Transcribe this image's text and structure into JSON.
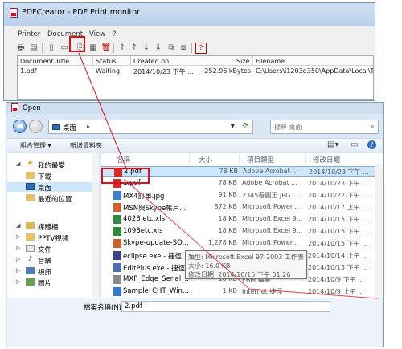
{
  "monitor": {
    "title": "PDFCreator - PDF Print monitor",
    "menu": [
      "Printer",
      "Document",
      "View",
      "?"
    ],
    "columns": [
      "Document Title",
      "Status",
      "Created on",
      "Size",
      "Filename"
    ],
    "row": {
      "title": "1.pdf",
      "status": "Waiting",
      "created": "2014/10/23 下午 ...",
      "size": "252.96 kBytes",
      "filename": "C:\\Users\\i1203q350\\AppData\\Local\\Temp\\M"
    }
  },
  "dialog": {
    "title": "Open",
    "address": "桌面",
    "search_placeholder": "搜尋 桌面",
    "organize": "組合管理 ▾",
    "new_folder": "新增資料夾",
    "nav": [
      {
        "label": "我的最愛",
        "icon": "star-icon"
      },
      {
        "label": "下載",
        "icon": "download-folder-icon"
      },
      {
        "label": "桌面",
        "icon": "desktop-icon"
      },
      {
        "label": "最近的位置",
        "icon": "recent-places-icon"
      },
      {
        "label": "媒體櫃",
        "icon": "library-icon"
      },
      {
        "label": "PPTV視頻",
        "icon": "folder-icon"
      },
      {
        "label": "文件",
        "icon": "documents-icon"
      },
      {
        "label": "音樂",
        "icon": "music-icon"
      },
      {
        "label": "視訊",
        "icon": "video-icon"
      },
      {
        "label": "圖片",
        "icon": "pictures-icon"
      }
    ],
    "columns": [
      "名稱",
      "大小",
      "項目類型",
      "修改日期"
    ],
    "files": [
      {
        "name": "2.pdf",
        "size": "78 KB",
        "type": "Adobe Acrobat ...",
        "date": "2014/10/23 下午 ...",
        "icon": "pdf-file-icon",
        "color": "#d42a2a"
      },
      {
        "name": "1.pdf",
        "size": "78 KB",
        "type": "Adobe Acrobat ...",
        "date": "2014/10/23 下午 ...",
        "icon": "pdf-file-icon",
        "color": "#d42a2a"
      },
      {
        "name": "MX4訂單.jpg",
        "size": "91 KB",
        "type": "2345看圖王 JPG ...",
        "date": "2014/10/22 下午 ...",
        "icon": "image-file-icon",
        "color": "#3b7fd1"
      },
      {
        "name": "MSN與Skype帳戶...",
        "size": "872 KB",
        "type": "Microsoft Power...",
        "date": "2014/10/17 上午 ...",
        "icon": "powerpoint-file-icon",
        "color": "#d0602a"
      },
      {
        "name": "4028 etc.xls",
        "size": "18 KB",
        "type": "Microsoft Excel 9...",
        "date": "2014/10/15 下午 ...",
        "icon": "excel-file-icon",
        "color": "#2a8a3c"
      },
      {
        "name": "1098etc.xls",
        "size": "18 KB",
        "type": "Microsoft Excel 9...",
        "date": "2014/10/15 下午 ...",
        "icon": "excel-file-icon",
        "color": "#2a8a3c"
      },
      {
        "name": "Skype-update-SO...",
        "size": "1,278 KB",
        "type": "Microsoft Power...",
        "date": "2014/10/15 下午 ...",
        "icon": "powerpoint-file-icon",
        "color": "#d0602a"
      },
      {
        "name": "eclipse.exe - 捷徑",
        "size": "",
        "type": "",
        "date": "2014/10/14 上午 ...",
        "icon": "eclipse-shortcut-icon",
        "color": "#3a3f8f"
      },
      {
        "name": "EditPlus.exe - 捷徑",
        "size": "",
        "type": "",
        "date": "2014/10/13 下午 ...",
        "icon": "editplus-shortcut-icon",
        "color": "#4a6fb8"
      },
      {
        "name": "MXP_Edge_Serial_...",
        "size": "18 KB",
        "type": "PRM 檔案",
        "date": "2014/10/9 下午 ...",
        "icon": "generic-file-icon",
        "color": "#8a8a8a"
      },
      {
        "name": "Sample_CHT_Win...",
        "size": "1 KB",
        "type": "Internet 捷徑",
        "date": "2014/10/9 上午 ...",
        "icon": "internet-shortcut-icon",
        "color": "#2d7bd2"
      }
    ],
    "tooltip": [
      "類型: Microsoft Excel 97-2003 工作表",
      "大小: 16.0 KB",
      "修改日期: 2014/10/15 下午 01:26"
    ],
    "filename_label": "檔案名稱(N):",
    "filename_value": "2.pdf"
  }
}
